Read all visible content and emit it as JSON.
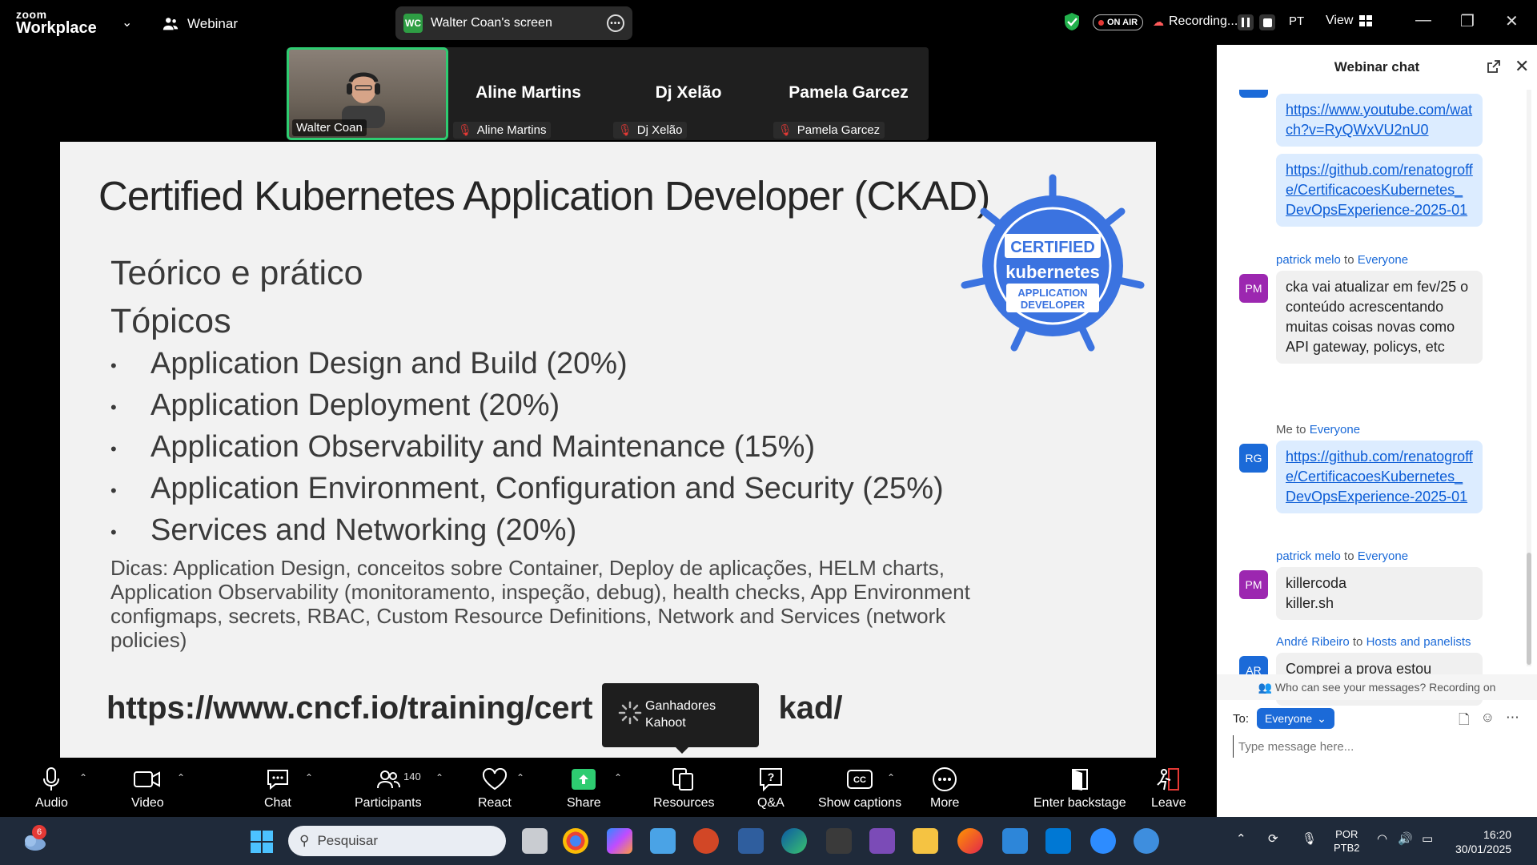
{
  "titlebar": {
    "logo_top": "zoom",
    "logo_bottom": "Workplace",
    "mode": "Webinar",
    "screen_badge": "WC",
    "screen_label": "Walter Coan's screen",
    "on_air": "ON AIR",
    "recording": "Recording...",
    "language": "PT",
    "view": "View"
  },
  "video_strip": {
    "host": {
      "label": "Walter Coan"
    },
    "panelists": [
      {
        "name": "Aline Martins",
        "label": "Aline Martins"
      },
      {
        "name": "Dj Xelão",
        "label": "Dj Xelão"
      },
      {
        "name": "Pamela Garcez",
        "label": "Pamela Garcez"
      }
    ]
  },
  "slide": {
    "title": "Certified Kubernetes Application Developer (CKAD)",
    "subtitle1": "Teórico e prático",
    "subtitle2": "Tópicos",
    "bullet_char": "•",
    "bullets": [
      "Application Design and Build (20%)",
      "Application Deployment (20%)",
      "Application Observability and Maintenance (15%)",
      "Application Environment, Configuration and Security (25%)",
      "Services and Networking (20%)"
    ],
    "tips": "Dicas: Application Design, conceitos sobre Container, Deploy de aplicações, HELM charts, Application Observability (monitoramento, inspeção, debug), health checks, App Environment configmaps, secrets, RBAC, Custom Resource Definitions, Network and Services (network policies)",
    "url": "https://www.cncf.io/training/cert",
    "url_tail": "kad/",
    "logo": {
      "line1": "CERTIFIED",
      "line2": "kubernetes",
      "line3": "APPLICATION",
      "line4": "DEVELOPER"
    }
  },
  "tooltip": {
    "line1": "Ganhadores",
    "line2": "Kahoot"
  },
  "toolbar": {
    "audio": "Audio",
    "video": "Video",
    "chat": "Chat",
    "participants": "Participants",
    "participants_count": "140",
    "react": "React",
    "share": "Share",
    "resources": "Resources",
    "qa": "Q&A",
    "captions": "Show captions",
    "more": "More",
    "backstage": "Enter backstage",
    "leave": "Leave"
  },
  "chat": {
    "title": "Webinar chat",
    "messages": [
      {
        "type": "link",
        "text": "https://www.youtube.com/watch?v=RyQWxVU2nU0"
      },
      {
        "type": "link",
        "text": "https://github.com/renatogroffe/CertificacoesKubernetes_DevOpsExperience-2025-01"
      },
      {
        "sender": "patrick melo",
        "to_word": "to",
        "recipient": "Everyone",
        "avatar": "PM",
        "text": "cka vai atualizar em  fev/25 o conteúdo acrescentando muitas coisas novas como API gateway, policys, etc"
      },
      {
        "sender": "Me",
        "to_word": "to",
        "recipient": "Everyone",
        "avatar": "RG",
        "text": "https://github.com/renatogroffe/CertificacoesKubernetes_DevOpsExperience-2025-01"
      },
      {
        "sender": "patrick melo",
        "to_word": "to",
        "recipient": "Everyone",
        "avatar": "PM",
        "text_line1": "killercoda",
        "text_line2": "killer.sh"
      },
      {
        "sender": "André Ribeiro",
        "to_word": "to",
        "recipient": "Hosts and panelists",
        "avatar": "AR",
        "text": "Comprei a prova estou estudando para fazer ela."
      }
    ],
    "privacy": "Who can see your messages? Recording on",
    "to_label": "To:",
    "to_value": "Everyone",
    "input_placeholder": "Type message here..."
  },
  "taskbar": {
    "weather_badge": "6",
    "search_placeholder": "Pesquisar",
    "lang_line1": "POR",
    "lang_line2": "PTB2",
    "time": "16:20",
    "date": "30/01/2025"
  },
  "colors": {
    "accent_blue": "#1b6ad8",
    "active_green": "#2ecc71",
    "k8s_blue": "#3b73e0",
    "taskbar": "#1f2a3a"
  }
}
